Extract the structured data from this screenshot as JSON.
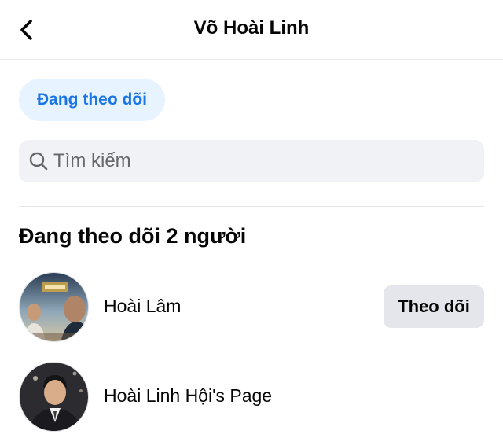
{
  "header": {
    "back_icon": "chevron-left-icon",
    "title": "Võ Hoài Linh"
  },
  "filter_chip": {
    "label": "Đang theo dõi",
    "background": "#e7f3ff",
    "text_color": "#1b74e4"
  },
  "search": {
    "icon": "search-icon",
    "placeholder": "Tìm kiếm",
    "value": ""
  },
  "section": {
    "title": "Đang theo dõi 2 người"
  },
  "following": [
    {
      "name": "Hoài Lâm",
      "avatar": "movie-poster-avatar",
      "button_label": "Theo dõi"
    },
    {
      "name": "Hoài Linh Hội's Page",
      "avatar": "person-photo-avatar"
    }
  ]
}
